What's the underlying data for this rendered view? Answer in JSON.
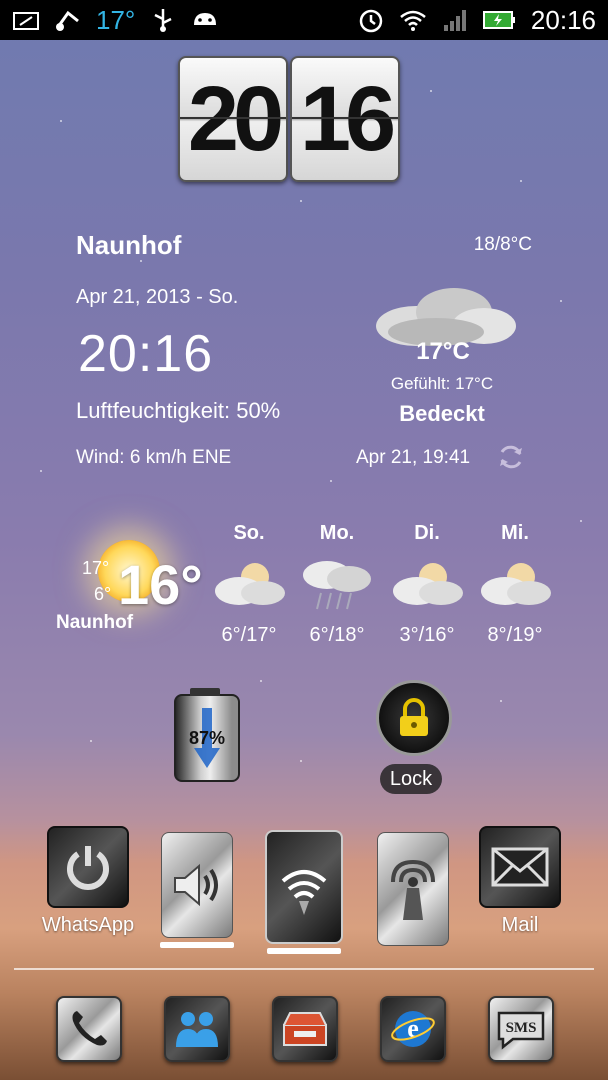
{
  "statusbar": {
    "temperature": "17°",
    "time": "20:16",
    "left_icons": [
      "screenshot-icon",
      "music-icon",
      "usb-icon",
      "android-debug-icon"
    ],
    "right_icons": [
      "alarm-icon",
      "wifi-icon",
      "signal-icon",
      "battery-charging-icon"
    ]
  },
  "flipclock": {
    "hours": "20",
    "minutes": "16"
  },
  "weather": {
    "city": "Naunhof",
    "hilo": "18/8°C",
    "date": "Apr 21, 2013 - So.",
    "time": "20:16",
    "humidity": "Luftfeuchtigkeit: 50%",
    "wind": "Wind: 6 km/h ENE",
    "current_temp": "17°C",
    "feels_like": "Gefühlt: 17°C",
    "condition": "Bedeckt",
    "updated": "Apr 21, 19:41",
    "condition_icon": "cloud-icon",
    "refresh_icon": "refresh-icon"
  },
  "forecast": {
    "current": {
      "high": "17°",
      "low": "6°",
      "temp": "16°",
      "city": "Naunhof",
      "icon": "sun-icon"
    },
    "days": [
      {
        "name": "So.",
        "range": "6°/17°",
        "icon": "partly-cloudy-icon"
      },
      {
        "name": "Mo.",
        "range": "6°/18°",
        "icon": "rain-cloud-icon"
      },
      {
        "name": "Di.",
        "range": "3°/16°",
        "icon": "partly-cloudy-icon"
      },
      {
        "name": "Mi.",
        "range": "8°/19°",
        "icon": "partly-cloudy-icon"
      }
    ]
  },
  "battery_widget": {
    "percent": "87%"
  },
  "lock_widget": {
    "label": "Lock"
  },
  "apps": [
    {
      "label": "WhatsApp",
      "icon": "power-icon"
    },
    {
      "label": "",
      "icon": "speaker-icon"
    },
    {
      "label": "",
      "icon": "wifi-hotspot-icon"
    },
    {
      "label": "",
      "icon": "antenna-icon"
    },
    {
      "label": "Mail",
      "icon": "mail-icon"
    }
  ],
  "dock": [
    "phone-icon",
    "people-icon",
    "toolbox-icon",
    "browser-icon",
    "sms-icon"
  ],
  "dock_sms_text": "SMS"
}
